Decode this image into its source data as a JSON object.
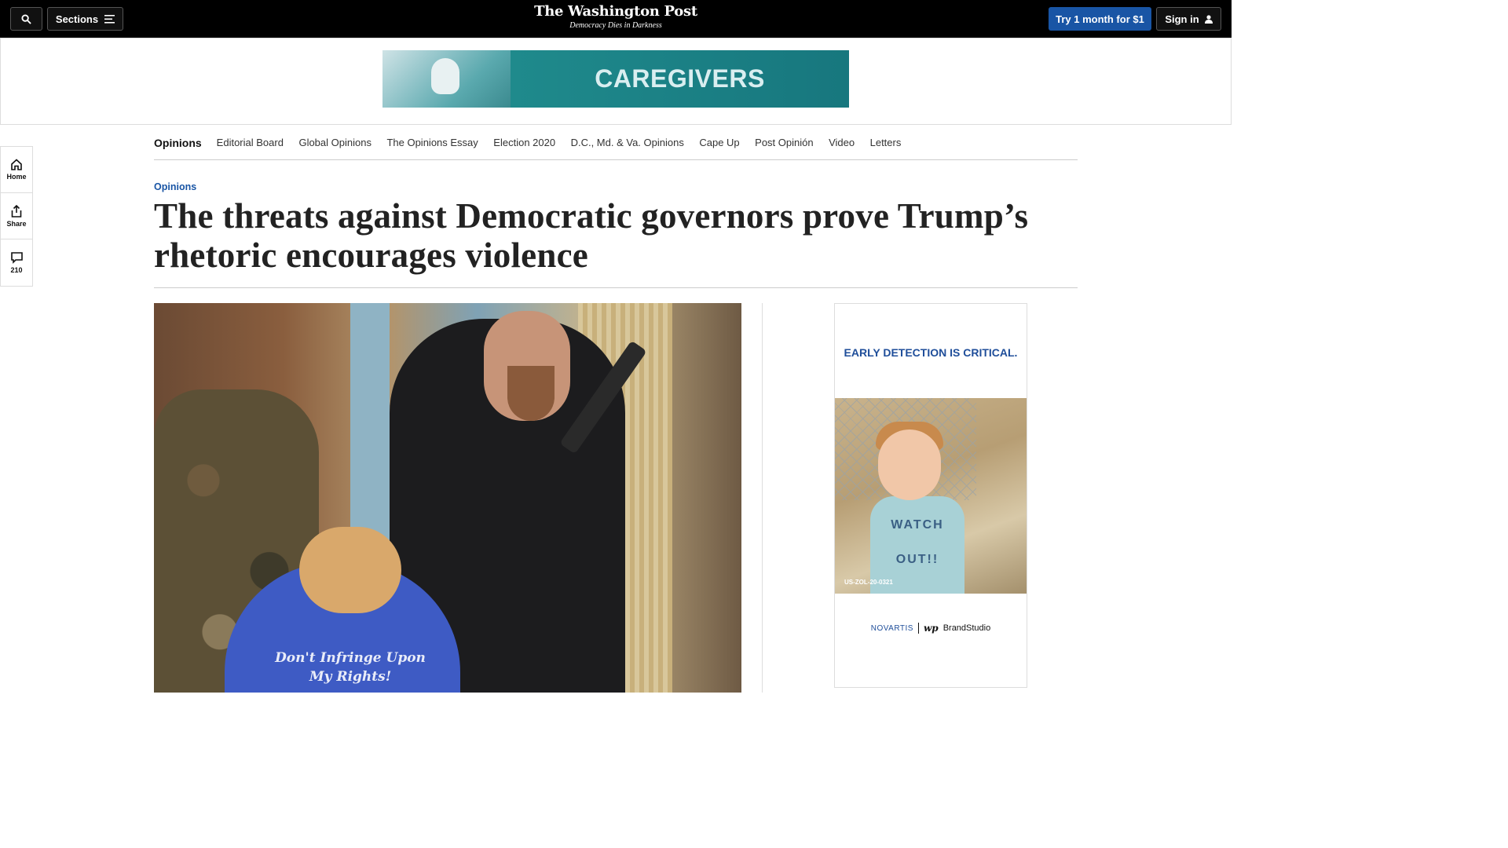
{
  "header": {
    "sections_label": "Sections",
    "logo": "The Washington Post",
    "tagline": "Democracy Dies in Darkness",
    "trial_label": "Try 1 month for $1",
    "signin_label": "Sign in"
  },
  "top_ad": {
    "text": "CAREGIVERS"
  },
  "rail": {
    "home_label": "Home",
    "share_label": "Share",
    "comments_count": "210"
  },
  "section_nav": {
    "current": "Opinions",
    "items": [
      "Editorial Board",
      "Global Opinions",
      "The Opinions Essay",
      "Election 2020",
      "D.C., Md. & Va. Opinions",
      "Cape Up",
      "Post Opinión",
      "Video",
      "Letters"
    ]
  },
  "article": {
    "kicker": "Opinions",
    "headline": "The threats against Democratic governors prove Trump’s rhetoric encourages violence",
    "image_text": "Don't Infringe Upon My Rights!"
  },
  "side_ad": {
    "headline": "EARLY DETECTION IS CRITICAL.",
    "shirt_text": "WATCH OUT!!",
    "code": "US-ZOL-20-0321",
    "sponsor": "NOVARTIS",
    "studio": "BrandStudio",
    "studio_mark": "wp"
  },
  "colors": {
    "brand_blue": "#1955a5",
    "topbar": "#000000",
    "ad_teal": "#17777e"
  },
  "icons": [
    "search-icon",
    "menu-icon",
    "user-icon",
    "home-icon",
    "share-icon",
    "comment-icon"
  ]
}
